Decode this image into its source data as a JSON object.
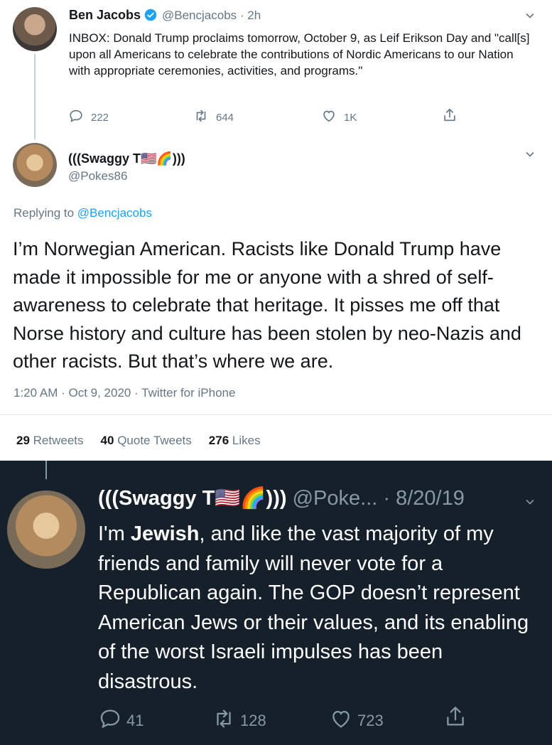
{
  "tweet1": {
    "name": "Ben Jacobs",
    "handle": "@Bencjacobs · 2h",
    "text": "INBOX: Donald Trump proclaims tomorrow, October 9, as Leif Erikson Day and \"call[s] upon all Americans to celebrate the contributions of Nordic Americans to our Nation with appropriate ceremonies, activities, and programs.\"",
    "replies": "222",
    "retweets": "644",
    "likes": "1K",
    "verified_color": "#1da1f2"
  },
  "tweet2": {
    "name": "(((Swaggy T🇺🇸🌈)))",
    "handle": "@Pokes86",
    "replying_prefix": "Replying to",
    "replying_to": "@Bencjacobs",
    "text": "I’m Norwegian American. Racists like Donald Trump have made it impossible for me or anyone with a shred of self-awareness to celebrate that heritage. It pisses me off that Norse history and culture has been stolen by neo-Nazis and other racists. But that’s where we are.",
    "meta": "1:20 AM · Oct 9, 2020 · Twitter for iPhone",
    "retweets_count": "29",
    "retweets_label": "Retweets",
    "quotes_count": "40",
    "quotes_label": "Quote Tweets",
    "likes_count": "276",
    "likes_label": "Likes"
  },
  "tweet3": {
    "name": "(((Swaggy T🇺🇸🌈)))",
    "handle": "@Poke... · 8/20/19",
    "text_prefix": "I'm ",
    "text_bold": "Jewish",
    "text_rest": ", and like the vast majority of my friends and family will never vote for a Republican again. The GOP doesn’t represent American Jews or their values, and its enabling of the worst Israeli impulses has been disastrous.",
    "replies": "41",
    "retweets": "128",
    "likes": "723",
    "background": "#15202b"
  },
  "icons": {
    "reply": "reply-icon",
    "retweet": "retweet-icon",
    "like": "heart-icon",
    "share": "share-icon",
    "more": "chevron-down-icon"
  }
}
